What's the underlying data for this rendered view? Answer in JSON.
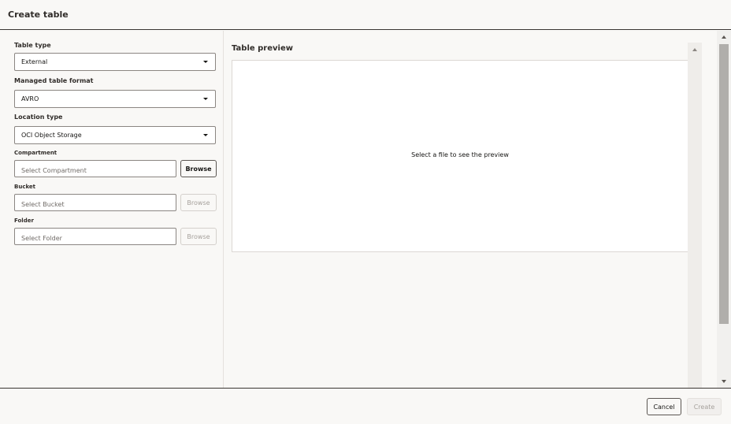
{
  "dialog": {
    "title": "Create table"
  },
  "form": {
    "table_type": {
      "label": "Table type",
      "value": "External"
    },
    "managed_table_format": {
      "label": "Managed table format",
      "value": "AVRO"
    },
    "location_type": {
      "label": "Location type",
      "value": "OCI Object Storage"
    },
    "compartment": {
      "label": "Compartment",
      "placeholder": "Select Compartment",
      "browse_label": "Browse",
      "browse_enabled": true
    },
    "bucket": {
      "label": "Bucket",
      "placeholder": "Select Bucket",
      "browse_label": "Browse",
      "browse_enabled": false
    },
    "folder": {
      "label": "Folder",
      "placeholder": "Select Folder",
      "browse_label": "Browse",
      "browse_enabled": false
    }
  },
  "preview": {
    "title": "Table preview",
    "empty_message": "Select a file to see the preview"
  },
  "footer": {
    "cancel_label": "Cancel",
    "create_label": "Create",
    "create_enabled": false
  },
  "icons": {
    "dropdown": "chevron-down-icon",
    "scroll_up": "scroll-up-arrow-icon",
    "scroll_down": "scroll-down-arrow-icon"
  }
}
